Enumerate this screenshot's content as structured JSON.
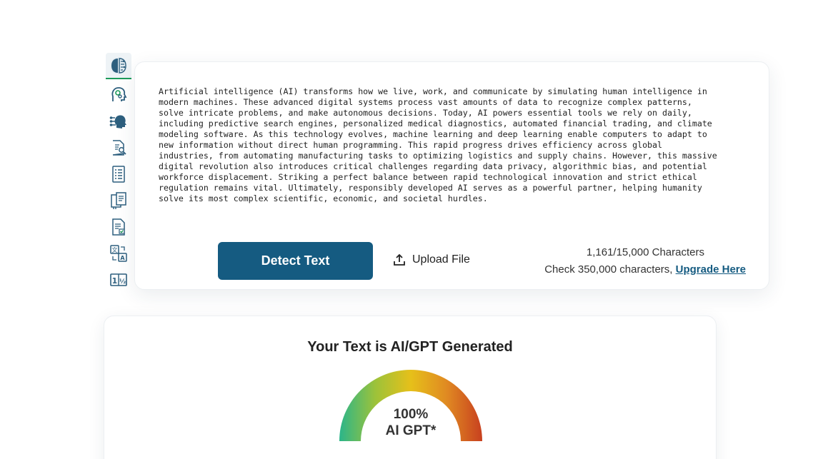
{
  "sidebar": {
    "items": [
      {
        "icon": "brain-chip-icon",
        "active": true
      },
      {
        "icon": "head-gears-icon"
      },
      {
        "icon": "ai-head-circuit-icon"
      },
      {
        "icon": "document-search-icon"
      },
      {
        "icon": "document-list-icon"
      },
      {
        "icon": "document-stack-icon"
      },
      {
        "icon": "document-check-icon"
      },
      {
        "icon": "translate-icon"
      },
      {
        "icon": "number-grid-icon"
      }
    ]
  },
  "input": {
    "text": "Artificial intelligence (AI) transforms how we live, work, and communicate by simulating human intelligence in\nmodern machines. These advanced digital systems process vast amounts of data to recognize complex patterns,\nsolve intricate problems, and make autonomous decisions. Today, AI powers essential tools we rely on daily,\nincluding predictive search engines, personalized medical diagnostics, automated financial trading, and climate\nmodeling software. As this technology evolves, machine learning and deep learning enable computers to adapt to\nnew information without direct human programming. This rapid progress drives efficiency across global\nindustries, from automating manufacturing tasks to optimizing logistics and supply chains. However, this massive\ndigital revolution also introduces critical challenges regarding data privacy, algorithmic bias, and potential\nworkforce displacement. Striking a perfect balance between rapid technological innovation and strict ethical\nregulation remains vital. Ultimately, responsibly developed AI serves as a powerful partner, helping humanity\nsolve its most complex scientific, economic, and societal hurdles.",
    "detect_label": "Detect Text",
    "upload_label": "Upload File",
    "char_count": "1,161/15,000 Characters",
    "upgrade_prefix": "Check 350,000 characters, ",
    "upgrade_link": "Upgrade Here"
  },
  "result": {
    "title": "Your Text is AI/GPT Generated",
    "percent": "100%",
    "label": "AI GPT*",
    "gauge_value": 1.0
  },
  "colors": {
    "primary": "#155b81",
    "gauge_start": "#2bb58a",
    "gauge_mid": "#e6c01a",
    "gauge_end": "#c8401f"
  }
}
